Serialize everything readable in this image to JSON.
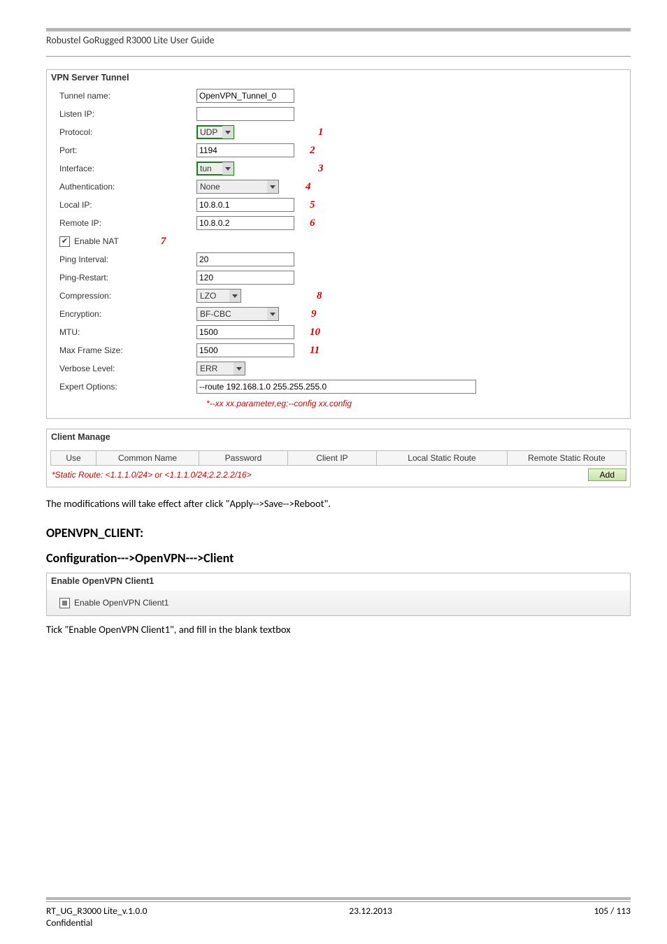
{
  "header": "Robustel GoRugged R3000 Lite User Guide",
  "vpn_server_tunnel": {
    "title": "VPN Server Tunnel",
    "rows": {
      "tunnel_name": {
        "label": "Tunnel name:",
        "value": "OpenVPN_Tunnel_0"
      },
      "listen_ip": {
        "label": "Listen IP:",
        "value": ""
      },
      "protocol": {
        "label": "Protocol:",
        "value": "UDP",
        "annot": "1"
      },
      "port": {
        "label": "Port:",
        "value": "1194",
        "annot": "2"
      },
      "interface": {
        "label": "Interface:",
        "value": "tun",
        "annot": "3"
      },
      "auth": {
        "label": "Authentication:",
        "value": "None",
        "annot": "4"
      },
      "local_ip": {
        "label": "Local IP:",
        "value": "10.8.0.1",
        "annot": "5"
      },
      "remote_ip": {
        "label": "Remote IP:",
        "value": "10.8.0.2",
        "annot": "6"
      },
      "enable_nat": {
        "label": "Enable NAT",
        "checked": true,
        "annot": "7"
      },
      "ping_interval": {
        "label": "Ping Interval:",
        "value": "20"
      },
      "ping_restart": {
        "label": "Ping-Restart:",
        "value": "120"
      },
      "compression": {
        "label": "Compression:",
        "value": "LZO",
        "annot": "8"
      },
      "encryption": {
        "label": "Encryption:",
        "value": "BF-CBC",
        "annot": "9"
      },
      "mtu": {
        "label": "MTU:",
        "value": "1500",
        "annot": "10"
      },
      "max_frame": {
        "label": "Max Frame Size:",
        "value": "1500",
        "annot": "11"
      },
      "verbose": {
        "label": "Verbose Level:",
        "value": "ERR"
      },
      "expert": {
        "label": "Expert Options:",
        "value": "--route 192.168.1.0 255.255.255.0"
      }
    },
    "hint": "*--xx xx.parameter,eg:--config xx.config"
  },
  "client_manage": {
    "title": "Client Manage",
    "cols": [
      "Use",
      "Common Name",
      "Password",
      "Client IP",
      "Local Static Route",
      "Remote Static Route"
    ],
    "note": "*Static Route: <1.1.1.0/24> or <1.1.1.0/24;2.2.2.2/16>",
    "add": "Add"
  },
  "body_text_1": "The modifications will take effect after click \"Apply-->Save-->Reboot\".",
  "heading_openvpn_client": "OPENVPN_CLIENT:",
  "heading_conf_path": "Configuration--->OpenVPN--->Client",
  "enable_client1": {
    "title": "Enable OpenVPN Client1",
    "label": "Enable OpenVPN Client1"
  },
  "body_text_2": "Tick \"Enable OpenVPN Client1\", and fill in the blank textbox",
  "footer": {
    "left1": "RT_UG_R3000 Lite_v.1.0.0",
    "center1": "23.12.2013",
    "right1": "105 / 113",
    "left2": "Confidential"
  }
}
